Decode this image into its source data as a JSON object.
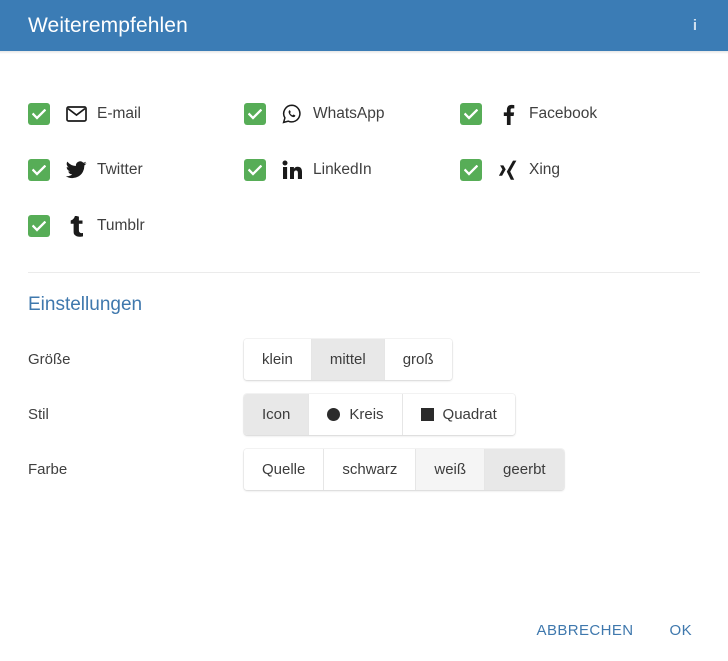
{
  "dialog": {
    "title": "Weiterempfehlen",
    "info_icon": "info-icon",
    "accent_color": "#3b7cb5",
    "link_color": "#3f78ad",
    "checkbox_color": "#57ad57"
  },
  "networks": [
    {
      "label": "E-mail",
      "icon": "envelope-icon",
      "checked": true
    },
    {
      "label": "WhatsApp",
      "icon": "whatsapp-icon",
      "checked": true
    },
    {
      "label": "Facebook",
      "icon": "facebook-icon",
      "checked": true
    },
    {
      "label": "Twitter",
      "icon": "twitter-icon",
      "checked": true
    },
    {
      "label": "LinkedIn",
      "icon": "linkedin-icon",
      "checked": true
    },
    {
      "label": "Xing",
      "icon": "xing-icon",
      "checked": true
    },
    {
      "label": "Tumblr",
      "icon": "tumblr-icon",
      "checked": true
    }
  ],
  "settings": {
    "heading": "Einstellungen",
    "rows": [
      {
        "label": "Größe",
        "name": "size",
        "options": [
          {
            "label": "klein",
            "state": "normal"
          },
          {
            "label": "mittel",
            "state": "selected"
          },
          {
            "label": "groß",
            "state": "normal"
          }
        ]
      },
      {
        "label": "Stil",
        "name": "style",
        "options": [
          {
            "label": "Icon",
            "state": "selected",
            "glyph": "none"
          },
          {
            "label": "Kreis",
            "state": "normal",
            "glyph": "circle"
          },
          {
            "label": "Quadrat",
            "state": "normal",
            "glyph": "square"
          }
        ]
      },
      {
        "label": "Farbe",
        "name": "color",
        "options": [
          {
            "label": "Quelle",
            "state": "normal"
          },
          {
            "label": "schwarz",
            "state": "normal"
          },
          {
            "label": "weiß",
            "state": "hovered"
          },
          {
            "label": "geerbt",
            "state": "selected"
          }
        ]
      }
    ]
  },
  "footer": {
    "cancel_label": "ABBRECHEN",
    "ok_label": "OK"
  }
}
